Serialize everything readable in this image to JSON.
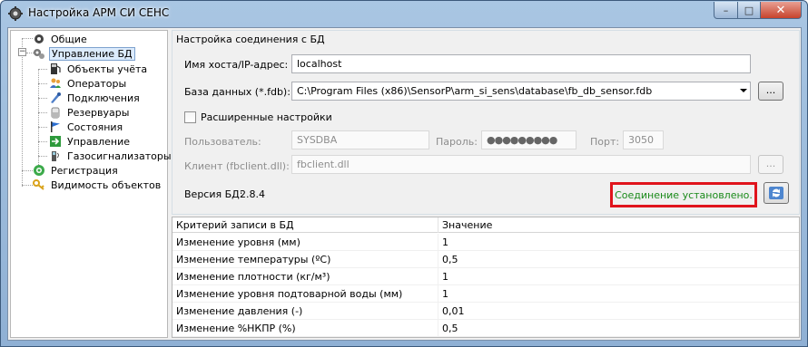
{
  "window": {
    "title": "Настройка АРМ СИ СЕНС",
    "controls": {
      "minimize": "–",
      "maximize": "□",
      "close": "✕"
    }
  },
  "tree": {
    "items": [
      {
        "label": "Общие",
        "icon": "gear-icon",
        "selected": false
      },
      {
        "label": "Управление БД",
        "icon": "gears-icon",
        "selected": true
      },
      {
        "label": "Объекты учёта",
        "icon": "fuel-pump-icon",
        "selected": false
      },
      {
        "label": "Операторы",
        "icon": "users-icon",
        "selected": false
      },
      {
        "label": "Подключения",
        "icon": "plug-icon",
        "selected": false
      },
      {
        "label": "Резервуары",
        "icon": "tank-icon",
        "selected": false
      },
      {
        "label": "Состояния",
        "icon": "flag-icon",
        "selected": false
      },
      {
        "label": "Управление",
        "icon": "control-arrow-icon",
        "selected": false
      },
      {
        "label": "Газосигнализаторы",
        "icon": "gas-sensor-icon",
        "selected": false
      },
      {
        "label": "Регистрация",
        "icon": "registration-icon",
        "selected": false
      },
      {
        "label": "Видимость объектов",
        "icon": "key-icon",
        "selected": false
      }
    ]
  },
  "connection": {
    "group_title": "Настройка соединения с БД",
    "host_label": "Имя хоста/IP-адрес:",
    "host_value": "localhost",
    "db_label": "База данных (*.fdb):",
    "db_value": "C:\\Program Files (x86)\\SensorP\\arm_si_sens\\database\\fb_db_sensor.fdb",
    "browse_label": "...",
    "advanced_label": "Расширенные настройки",
    "user_label": "Пользователь:",
    "user_value": "SYSDBA",
    "password_label": "Пароль:",
    "password_value": "●●●●●●●●●",
    "port_label": "Порт:",
    "port_value": "3050",
    "client_label": "Клиент (fbclient.dll):",
    "client_value": "fbclient.dll",
    "client_browse_label": "...",
    "version_label": "Версия БД:",
    "version_value": "2.8.4",
    "status_text": "Соединение установлено.",
    "status_color": "#1a8a1a",
    "highlight_color": "#e0141c"
  },
  "criteria_table": {
    "headers": [
      "Критерий записи в БД",
      "Значение"
    ],
    "rows": [
      {
        "criterion": "Изменение уровня (мм)",
        "value": "1"
      },
      {
        "criterion": "Изменение температуры (ºС)",
        "value": "0,5"
      },
      {
        "criterion": "Изменение плотности (кг/м³)",
        "value": "1"
      },
      {
        "criterion": "Изменение уровня подтоварной воды (мм)",
        "value": "1"
      },
      {
        "criterion": "Изменение давления (-)",
        "value": "0,01"
      },
      {
        "criterion": "Изменение %НКПР (%)",
        "value": "0,5"
      }
    ]
  }
}
